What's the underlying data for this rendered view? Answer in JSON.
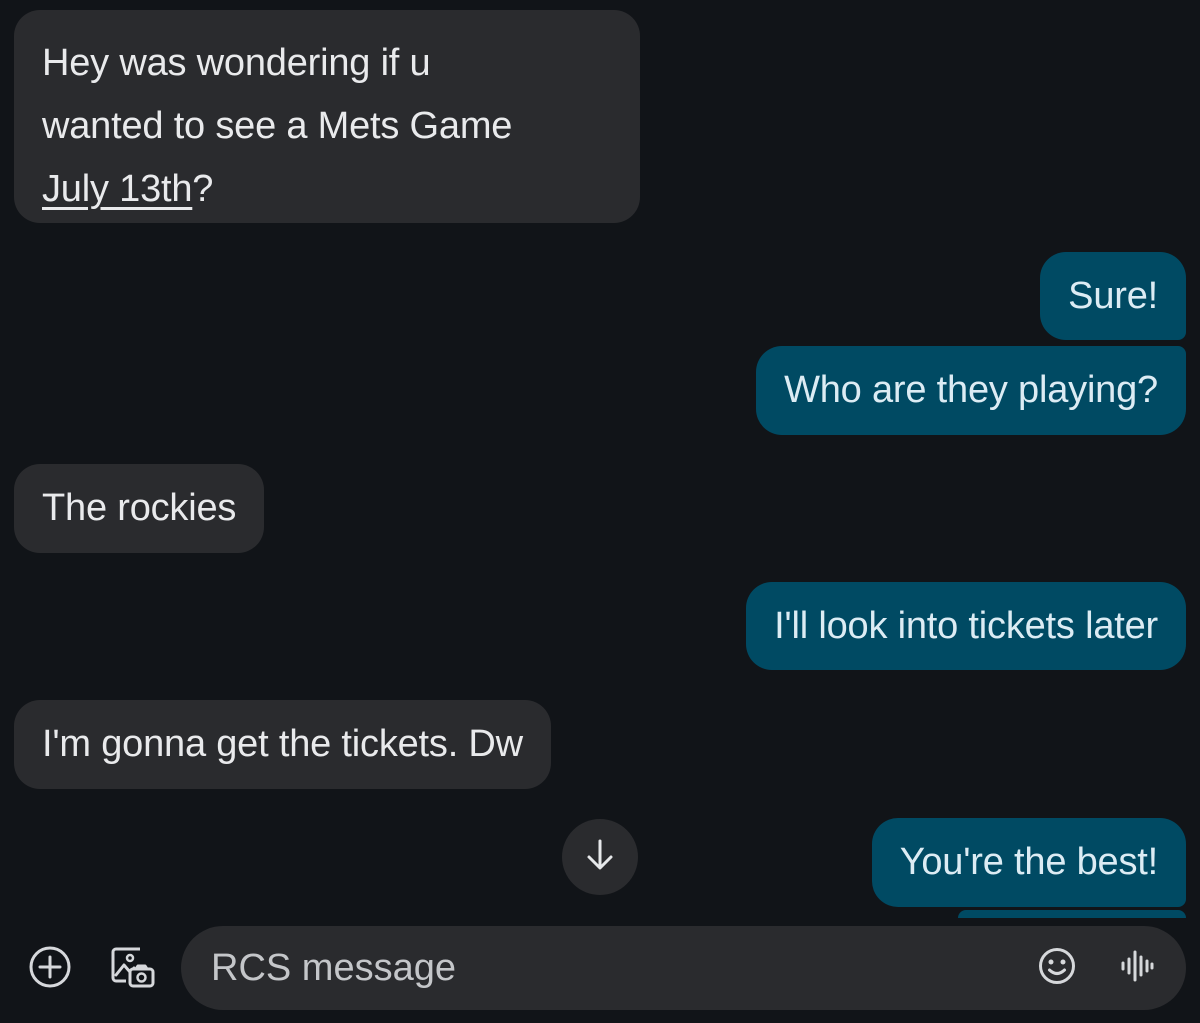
{
  "messages": [
    {
      "direction": "incoming",
      "lines": [
        "Hey was wondering if u",
        "wanted to see a Mets Game"
      ],
      "link_text": "July 13th",
      "trailing_text": "?"
    },
    {
      "direction": "outgoing",
      "text": "Sure!"
    },
    {
      "direction": "outgoing",
      "text": "Who are they playing?"
    },
    {
      "direction": "incoming",
      "text": "The rockies"
    },
    {
      "direction": "outgoing",
      "text": "I'll look into tickets later"
    },
    {
      "direction": "incoming",
      "text": "I'm gonna get the tickets. Dw"
    },
    {
      "direction": "outgoing",
      "text": "You're the best!"
    }
  ],
  "composer": {
    "placeholder": "RCS message"
  },
  "icons": {
    "add": "add-circle-icon",
    "gallery": "gallery-camera-icon",
    "emoji": "emoji-icon",
    "voice": "voice-waveform-icon",
    "scroll": "arrow-down-icon"
  },
  "colors": {
    "background": "#111418",
    "incoming_bubble": "#2a2b2e",
    "outgoing_bubble": "#004a63",
    "text": "#e9eaec"
  }
}
